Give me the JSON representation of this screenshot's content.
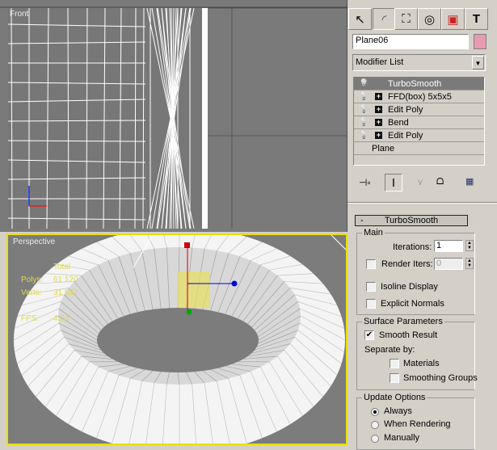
{
  "viewports": {
    "top": {
      "label": "Front"
    },
    "perspective": {
      "label": "Perspective",
      "stats": {
        "header": "Total",
        "polys_label": "Polys:",
        "polys": "61 120",
        "verts_label": "Verts:",
        "verts": "31 937",
        "fps_label": "FPS:",
        "fps": "4.63"
      }
    }
  },
  "panel": {
    "tabs": [
      "create-icon",
      "modify-icon",
      "hierarchy-icon",
      "motion-icon",
      "display-icon",
      "utilities-icon"
    ],
    "object_name": "Plane06",
    "object_color": "#e89ab0",
    "modifier_list": "Modifier List",
    "stack": [
      {
        "label": "TurboSmooth",
        "selected": true,
        "expandable": false
      },
      {
        "label": "FFD(box) 5x5x5",
        "expandable": true
      },
      {
        "label": "Edit Poly",
        "expandable": true
      },
      {
        "label": "Bend",
        "expandable": true
      },
      {
        "label": "Edit Poly",
        "expandable": true
      },
      {
        "label": "Plane",
        "base": true
      }
    ],
    "rollout": {
      "collapse": "-",
      "title": "TurboSmooth",
      "main": {
        "title": "Main",
        "iterations_label": "Iterations:",
        "iterations": "1",
        "render_iters_label": "Render Iters:",
        "render_iters": "0",
        "render_iters_checked": false,
        "isoline": "Isoline Display",
        "isoline_checked": false,
        "explicit": "Explicit Normals",
        "explicit_checked": false
      },
      "surface": {
        "title": "Surface Parameters",
        "smooth_result": "Smooth Result",
        "smooth_checked": true,
        "separate_by": "Separate by:",
        "materials": "Materials",
        "smoothing_groups": "Smoothing Groups"
      },
      "update": {
        "title": "Update Options",
        "options": [
          "Always",
          "When Rendering",
          "Manually"
        ],
        "selected": "Always"
      }
    }
  }
}
